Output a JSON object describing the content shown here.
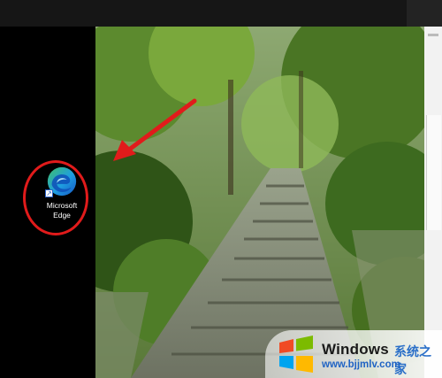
{
  "desktop": {
    "icon": {
      "label_line1": "Microsoft",
      "label_line2": "Edge",
      "icon_name": "edge-icon"
    }
  },
  "watermark": {
    "title": "Windows",
    "subtitle_cn": "系统之家",
    "url": "www.bjjmlv.com"
  },
  "colors": {
    "highlight": "#e11b1b",
    "edge_blue": "#1e7ed6",
    "edge_green": "#3fbf6a",
    "watermark_blue": "#1f63c4"
  }
}
